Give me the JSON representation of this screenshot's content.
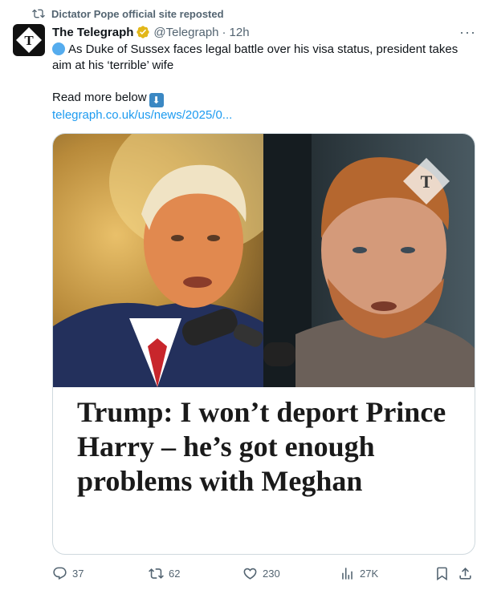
{
  "repost": {
    "text": "Dictator Pope official site reposted"
  },
  "tweet": {
    "name": "The Telegraph",
    "handle": "@Telegraph",
    "separator": "·",
    "time": "12h",
    "more": "···",
    "line1": "As Duke of Sussex faces legal battle over his visa status, president takes aim at his ‘terrible’ wife",
    "line2": "Read more below",
    "link": "telegraph.co.uk/us/news/2025/0..."
  },
  "card": {
    "headline": "Trump: I won’t deport Prince Harry – he’s got enough problems with Meghan"
  },
  "actions": {
    "replies": "37",
    "reposts": "62",
    "likes": "230",
    "views": "27K"
  },
  "colors": {
    "accent": "#1d9bf0",
    "muted": "#536471",
    "verified": "#e2b719"
  }
}
